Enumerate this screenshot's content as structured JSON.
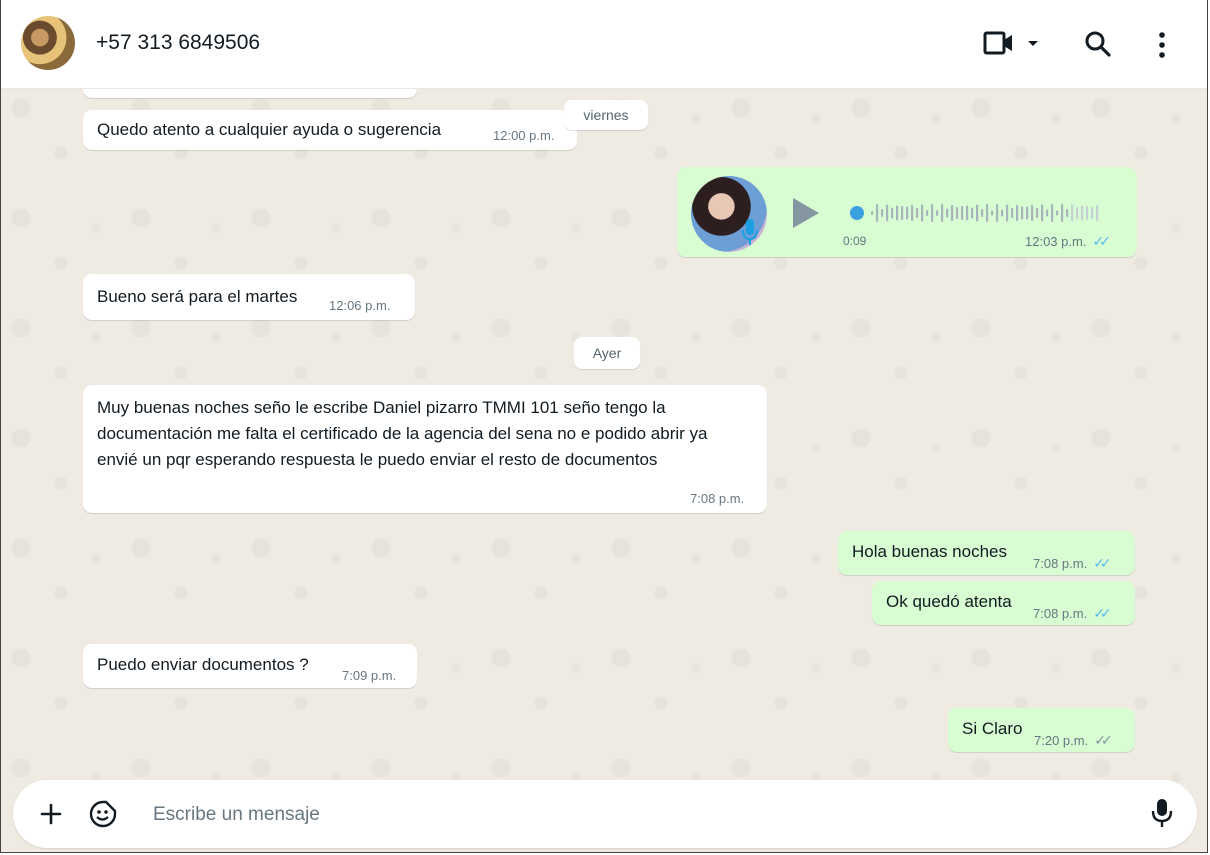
{
  "header": {
    "contact_name": "+57 313 6849506"
  },
  "chat": {
    "date_pills": [
      "viernes",
      "Ayer"
    ],
    "messages": [
      {
        "direction": "in",
        "text": "Quedo atento a cualquier ayuda o sugerencia",
        "time": "12:00 p.m."
      },
      {
        "direction": "out",
        "type": "voice",
        "duration": "0:09",
        "time": "12:03 p.m.",
        "status": "read"
      },
      {
        "direction": "in",
        "text": "Bueno será para el martes",
        "time": "12:06 p.m."
      },
      {
        "direction": "in",
        "text": "Muy buenas noches seño le escribe Daniel pizarro TMMI 101 seño tengo la documentación me falta el certificado de la agencia del sena no e podido abrir ya envié  un pqr esperando respuesta le puedo enviar el resto de documentos",
        "time": "7:08 p.m."
      },
      {
        "direction": "out",
        "text": "Hola buenas noches",
        "time": "7:08 p.m.",
        "status": "read"
      },
      {
        "direction": "out",
        "text": "Ok quedó atenta",
        "time": "7:08 p.m.",
        "status": "read"
      },
      {
        "direction": "in",
        "text": "Puedo enviar documentos ?",
        "time": "7:09 p.m."
      },
      {
        "direction": "out",
        "text": "Si Claro",
        "time": "7:20 p.m.",
        "status": "delivered"
      }
    ]
  },
  "composer": {
    "placeholder": "Escribe un mensaje"
  },
  "icons": {
    "header": [
      "video-call-icon",
      "chevron-down-icon",
      "search-icon",
      "menu-icon"
    ],
    "composer": [
      "plus-icon",
      "sticker-icon",
      "microphone-icon"
    ],
    "read_tick_color": "#53bdeb",
    "outgoing_bubble_color": "#d9fdd3",
    "accent": "#00a884"
  }
}
